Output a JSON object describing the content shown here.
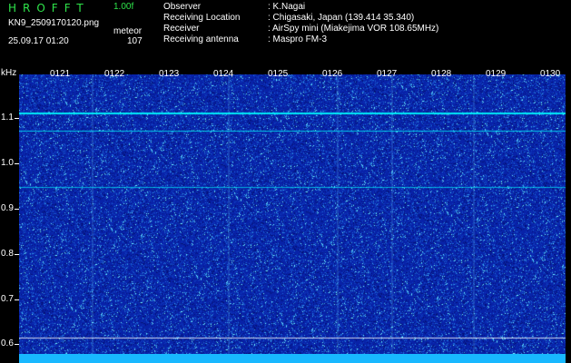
{
  "header": {
    "app_title": "HROFFT",
    "version": "1.00f",
    "filename": "KN9_2509170120.png",
    "mode": "meteor",
    "datetime": "25.09.17 01:20",
    "count": "107"
  },
  "info": {
    "rows": [
      {
        "key": "Observer",
        "value": ": K.Nagai"
      },
      {
        "key": "Receiving Location",
        "value": ": Chigasaki, Japan (139.414 35.340)"
      },
      {
        "key": "Receiver",
        "value": ": AirSpy mini (Miakejima VOR 108.65MHz)"
      },
      {
        "key": "Receiving antenna",
        "value": ": Maspro FM-3"
      }
    ]
  },
  "spectrogram": {
    "unit": "kHz",
    "time_ticks": [
      "0121",
      "0122",
      "0123",
      "0124",
      "0125",
      "0126",
      "0127",
      "0128",
      "0129",
      "0130"
    ],
    "freq_ticks": [
      "1.1",
      "1.0",
      "0.9",
      "0.8",
      "0.7",
      "0.6"
    ],
    "background_color": "#0822a8",
    "signal_color": "#00ffff"
  }
}
